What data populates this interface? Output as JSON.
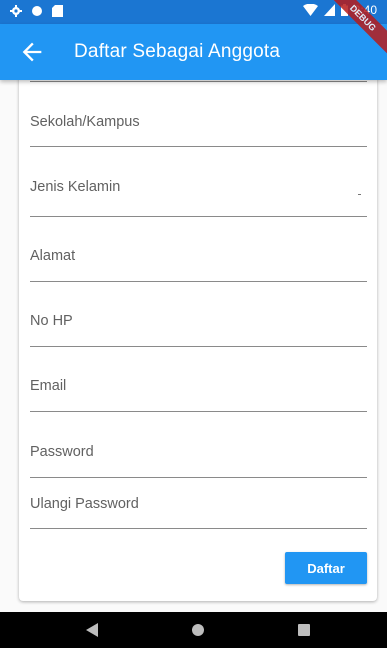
{
  "status_bar": {
    "time": "2:40",
    "left_icons": [
      "gear-icon",
      "circle-icon",
      "sd-card-icon"
    ],
    "right_icons": [
      "wifi-icon",
      "signal-icon",
      "battery-icon"
    ]
  },
  "app_bar": {
    "title": "Daftar Sebagai Anggota",
    "back_icon": "arrow-back-icon",
    "color": "#2196f3"
  },
  "debug_banner": "DEBUG",
  "form": {
    "fields": [
      {
        "label": "Sekolah/Kampus"
      },
      {
        "label": "Jenis Kelamin"
      },
      {
        "label": "Alamat"
      },
      {
        "label": "No HP"
      },
      {
        "label": "Email"
      },
      {
        "label": "Password"
      },
      {
        "label": "Ulangi Password"
      }
    ],
    "submit_label": "Daftar"
  },
  "nav_bar": {
    "icons": [
      "nav-back-icon",
      "nav-home-icon",
      "nav-recent-icon"
    ]
  }
}
